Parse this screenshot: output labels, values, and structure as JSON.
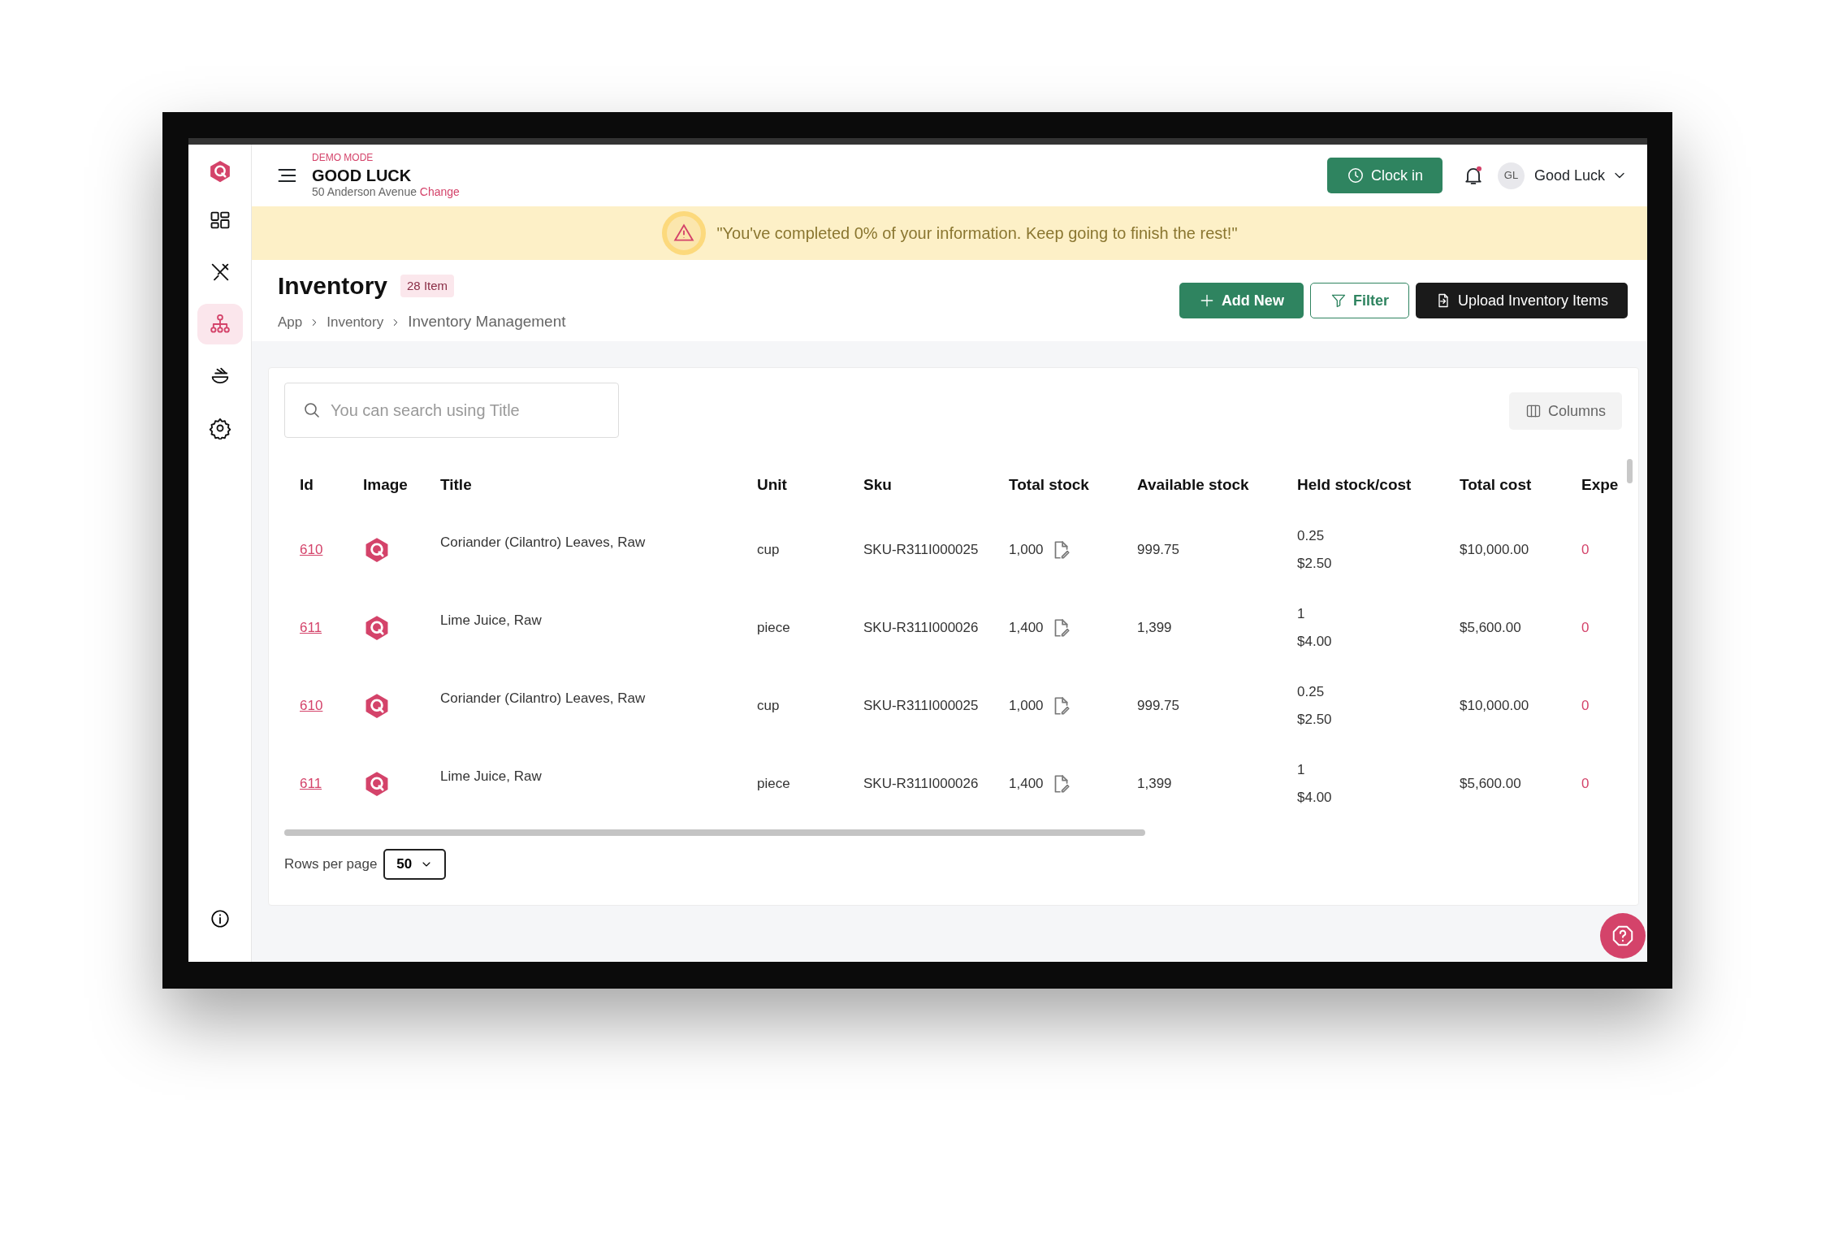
{
  "header": {
    "demo_label": "DEMO MODE",
    "business_name": "GOOD LUCK",
    "address": "50 Anderson Avenue",
    "change_link": "Change",
    "clock_in": "Clock in",
    "notifications_unread": true,
    "user_initials": "GL",
    "user_name": "Good Luck"
  },
  "sidebar": {
    "items": [
      {
        "kind": "dashboard",
        "selected": false
      },
      {
        "kind": "utensils",
        "selected": false
      },
      {
        "kind": "hierarchy",
        "selected": true
      },
      {
        "kind": "bowl",
        "selected": false
      },
      {
        "kind": "settings",
        "selected": false
      }
    ]
  },
  "banner": {
    "text": "\"You've completed 0% of your information. Keep going to finish the rest!\""
  },
  "page": {
    "title": "Inventory",
    "count_badge": "28 Item",
    "breadcrumb": [
      "App",
      "Inventory",
      "Inventory Management"
    ],
    "actions": [
      {
        "kind": "add",
        "label": "Add New"
      },
      {
        "kind": "filter",
        "label": "Filter"
      },
      {
        "kind": "upload",
        "label": "Upload Inventory Items"
      }
    ]
  },
  "search": {
    "placeholder": "You can search using Title"
  },
  "columns_button": "Columns",
  "table": {
    "columns": [
      "Id",
      "Image",
      "Title",
      "Unit",
      "Sku",
      "Total stock",
      "Available stock",
      "Held stock/cost",
      "Total cost",
      "Expe"
    ],
    "rows": [
      {
        "id": "610",
        "title": "Coriander (Cilantro) Leaves, Raw",
        "unit": "cup",
        "sku": "SKU-R311I000025",
        "total_stock": "1,000",
        "available_stock": "999.75",
        "held_stock": "0.25",
        "held_cost": "$2.50",
        "total_cost": "$10,000.00",
        "column_10": "0"
      },
      {
        "id": "611",
        "title": "Lime Juice, Raw",
        "unit": "piece",
        "sku": "SKU-R311I000026",
        "total_stock": "1,400",
        "available_stock": "1,399",
        "held_stock": "1",
        "held_cost": "$4.00",
        "total_cost": "$5,600.00",
        "column_10": "0"
      },
      {
        "id": "610",
        "title": "Coriander (Cilantro) Leaves, Raw",
        "unit": "cup",
        "sku": "SKU-R311I000025",
        "total_stock": "1,000",
        "available_stock": "999.75",
        "held_stock": "0.25",
        "held_cost": "$2.50",
        "total_cost": "$10,000.00",
        "column_10": "0"
      },
      {
        "id": "611",
        "title": "Lime Juice, Raw",
        "unit": "piece",
        "sku": "SKU-R311I000026",
        "total_stock": "1,400",
        "available_stock": "1,399",
        "held_stock": "1",
        "held_cost": "$4.00",
        "total_cost": "$5,600.00",
        "column_10": "0"
      }
    ]
  },
  "pagination": {
    "label": "Rows per page",
    "value": "50"
  }
}
